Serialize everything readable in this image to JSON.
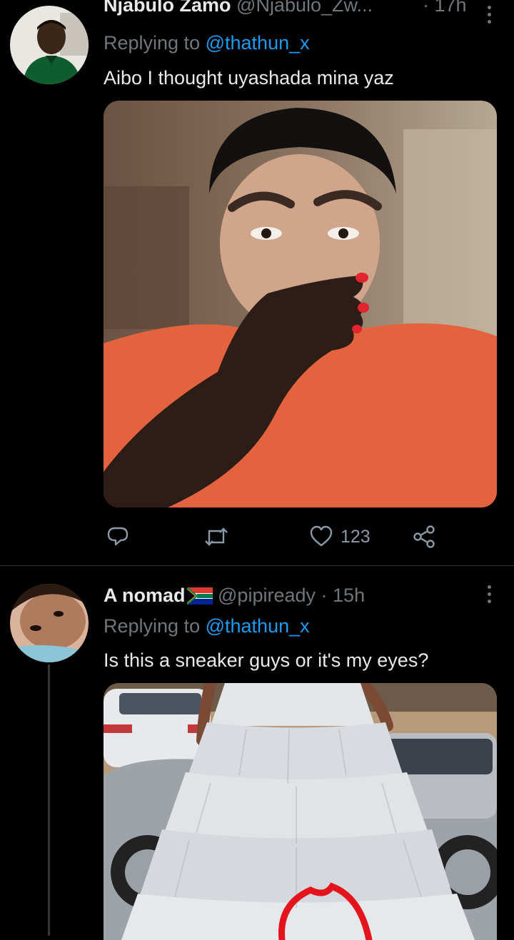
{
  "tweets": [
    {
      "name": "Njabulo Zamo",
      "handle": "@Njabulo_Zw...",
      "time": "17h",
      "reply_prefix": "Replying to",
      "reply_to": "@thathun_x",
      "text": "Aibo I thought uyashada mina yaz",
      "actions": {
        "reply_count": "",
        "retweet_count": "",
        "like_count": "123"
      }
    },
    {
      "name": "A nomad",
      "handle": "@pipiready",
      "time": "15h",
      "reply_prefix": "Replying to",
      "reply_to": "@thathun_x",
      "text": "Is this a sneaker guys or it's my eyes?"
    }
  ],
  "separator": "·",
  "icons": [
    "more-vertical-icon",
    "reply-icon",
    "retweet-icon",
    "like-icon",
    "share-icon",
    "south-africa-flag-icon"
  ],
  "colors": {
    "background": "#000000",
    "text": "#e7e9ea",
    "muted": "#71767b",
    "accent": "#1d9bf0",
    "annotation": "#e3141c"
  }
}
